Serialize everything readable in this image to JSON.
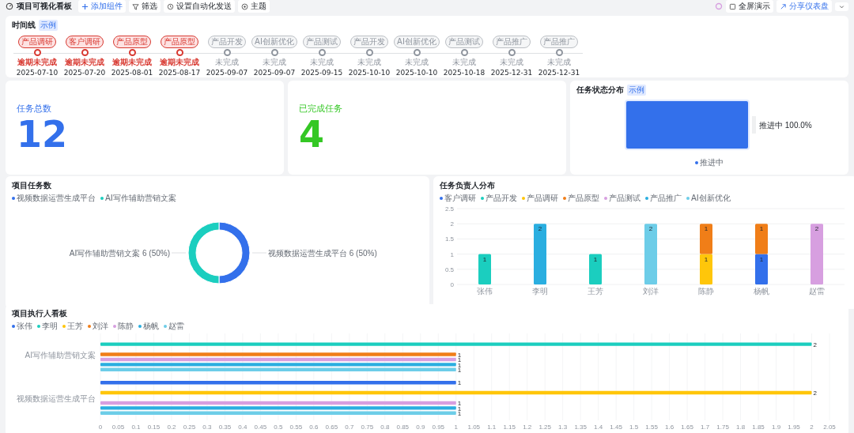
{
  "toolbar": {
    "title": "项目可视化看板",
    "buttons": [
      {
        "label": "添加组件",
        "kind": "primary"
      },
      {
        "label": "筛选",
        "kind": "default"
      },
      {
        "label": "设置自动化发送",
        "kind": "default"
      },
      {
        "label": "主题",
        "kind": "default"
      }
    ],
    "right_buttons": [
      {
        "label": "全屏演示",
        "kind": "default"
      },
      {
        "label": "分享仪表盘",
        "kind": "primary"
      }
    ]
  },
  "timeline": {
    "title": "时间线",
    "tag": "示例",
    "items": [
      {
        "label": "产品调研",
        "overdue": true,
        "status": "逾期未完成",
        "date": "2025-07-10"
      },
      {
        "label": "客户调研",
        "overdue": true,
        "status": "逾期未完成",
        "date": "2025-07-20"
      },
      {
        "label": "产品原型",
        "overdue": true,
        "status": "逾期未完成",
        "date": "2025-08-01"
      },
      {
        "label": "产品原型",
        "overdue": true,
        "status": "逾期未完成",
        "date": "2025-08-17"
      },
      {
        "label": "产品开发",
        "overdue": false,
        "status": "未完成",
        "date": "2025-09-07"
      },
      {
        "label": "AI创新优化",
        "overdue": false,
        "status": "未完成",
        "date": "2025-09-07"
      },
      {
        "label": "产品测试",
        "overdue": false,
        "status": "未完成",
        "date": "2025-09-15"
      },
      {
        "label": "产品开发",
        "overdue": false,
        "status": "未完成",
        "date": "2025-10-10"
      },
      {
        "label": "AI创新优化",
        "overdue": false,
        "status": "未完成",
        "date": "2025-10-10"
      },
      {
        "label": "产品测试",
        "overdue": false,
        "status": "未完成",
        "date": "2025-10-18"
      },
      {
        "label": "产品推广",
        "overdue": false,
        "status": "未完成",
        "date": "2025-12-31"
      },
      {
        "label": "产品推广",
        "overdue": false,
        "status": "未完成",
        "date": "2025-12-31"
      }
    ]
  },
  "stats": [
    {
      "label": "任务总数",
      "value": "12",
      "color": "#3370eb"
    },
    {
      "label": "已完成任务",
      "value": "4",
      "color": "#34c724"
    }
  ],
  "status_chart": {
    "title": "任务状态分布",
    "tag": "示例",
    "segments": [
      {
        "name": "推进中",
        "label": "推进中 100.0%"
      }
    ]
  },
  "project_chart": {
    "title": "项目任务数",
    "chart_data": {
      "type": "donut",
      "categories": [
        "视频数据运营生成平台",
        "AI写作辅助营销文案"
      ],
      "legend": "top",
      "values": [
        6,
        6
      ],
      "value_labels": [
        "视频数据运营生成平台 6 (50%)",
        "AI写作辅助营销文案 6 (50%)"
      ]
    }
  },
  "owner_chart": {
    "title": "任务负责人分布",
    "chart_data": {
      "type": "bar",
      "stacked": true,
      "categories": [
        "张伟",
        "李明",
        "王芳",
        "刘洋",
        "陈静",
        "杨帆",
        "赵雷"
      ],
      "grid": true,
      "legend": "top",
      "ylim": [
        0,
        2.5
      ],
      "yticks": [
        0,
        0.5,
        1,
        1.5,
        2,
        2.5
      ],
      "data_labels": true,
      "series": [
        {
          "name": "客户调研",
          "color": "#3370eb",
          "values": [
            null,
            null,
            null,
            null,
            null,
            1,
            null
          ]
        },
        {
          "name": "产品开发",
          "color": "#1bcebf",
          "values": [
            1,
            null,
            1,
            null,
            null,
            null,
            null
          ]
        },
        {
          "name": "产品调研",
          "color": "#ffc60a",
          "values": [
            null,
            null,
            null,
            null,
            1,
            null,
            null
          ]
        },
        {
          "name": "产品原型",
          "color": "#f07e18",
          "values": [
            null,
            null,
            null,
            null,
            1,
            1,
            null
          ]
        },
        {
          "name": "产品测试",
          "color": "#d79fe0",
          "values": [
            null,
            null,
            null,
            null,
            null,
            null,
            2
          ]
        },
        {
          "name": "产品推广",
          "color": "#2aaee0",
          "values": [
            null,
            2,
            null,
            null,
            null,
            null,
            null
          ]
        },
        {
          "name": "AI创新优化",
          "color": "#6dcde8",
          "values": [
            null,
            null,
            null,
            2,
            null,
            null,
            null
          ]
        }
      ]
    }
  },
  "executor_chart": {
    "title": "项目执行人看板",
    "chart_data": {
      "type": "bar",
      "orientation": "horizontal",
      "categories": [
        "AI写作辅助营销文案",
        "视频数据运营生成平台"
      ],
      "grid": true,
      "legend": "top",
      "xlim": [
        0,
        2.05
      ],
      "xticks": [
        0,
        0.05,
        0.1,
        0.15,
        0.2,
        0.25,
        0.3,
        0.35,
        0.4,
        0.45,
        0.5,
        0.55,
        0.6,
        0.65,
        0.7,
        0.75,
        0.8,
        0.85,
        0.9,
        0.95,
        1,
        1.05,
        1.1,
        1.15,
        1.2,
        1.25,
        1.3,
        1.35,
        1.4,
        1.45,
        1.5,
        1.55,
        1.6,
        1.65,
        1.7,
        1.75,
        1.8,
        1.85,
        1.9,
        1.95,
        2,
        2.05
      ],
      "data_labels": true,
      "series": [
        {
          "name": "张伟",
          "color": "#3370eb",
          "values": [
            null,
            1
          ]
        },
        {
          "name": "李明",
          "color": "#1bcebf",
          "values": [
            2,
            null
          ]
        },
        {
          "name": "王芳",
          "color": "#ffc60a",
          "values": [
            null,
            2
          ]
        },
        {
          "name": "刘洋",
          "color": "#f07e18",
          "values": [
            1,
            null
          ]
        },
        {
          "name": "陈静",
          "color": "#d79fe0",
          "values": [
            1,
            1
          ]
        },
        {
          "name": "杨帆",
          "color": "#2aaee0",
          "values": [
            1,
            1
          ]
        },
        {
          "name": "赵雷",
          "color": "#6dcde8",
          "values": [
            1,
            1
          ]
        }
      ]
    }
  }
}
